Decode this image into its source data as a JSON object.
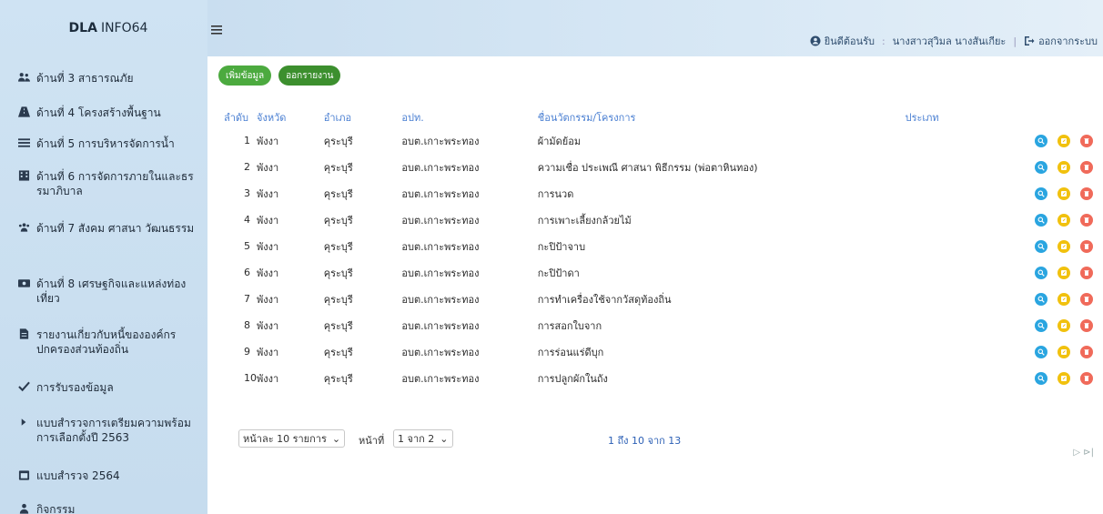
{
  "app": {
    "brand_bold": "DLA",
    "brand_light": "INFO64"
  },
  "sidebar": {
    "items": [
      {
        "icon": "users-icon",
        "label": "ด้านที่ 3 สาธารณภัย"
      },
      {
        "icon": "road-icon",
        "label": "ด้านที่ 4 โครงสร้างพื้นฐาน"
      },
      {
        "icon": "water-icon",
        "label": "ด้านที่ 5 การบริหารจัดการน้ำ"
      },
      {
        "icon": "building-icon",
        "label": "ด้านที่ 6 การจัดการภายในและธรรมาภิบาล"
      },
      {
        "icon": "group-icon",
        "label": "ด้านที่ 7 สังคม ศาสนา วัฒนธรรม"
      },
      {
        "icon": "ticket-icon",
        "label": "ด้านที่ 8 เศรษฐกิจและแหล่งท่องเที่ยว"
      },
      {
        "icon": "document-icon",
        "label": "รายงานเกี่ยวกับหนี้ขององค์กรปกครองส่วนท้องถิ่น"
      },
      {
        "icon": "check-icon",
        "label": "การรับรองข้อมูล"
      },
      {
        "icon": "chevron-right-icon",
        "label": "แบบสำรวจการเตรียมความพร้อมการเลือกตั้งปี 2563"
      },
      {
        "icon": "calendar-icon",
        "label": "แบบสำรวจ 2564"
      },
      {
        "icon": "user-icon",
        "label": "กิจกรรม"
      }
    ]
  },
  "topbar": {
    "welcome": "ยินดีต้อนรับ",
    "username": "นางสาวสุวิมล นางสันเกียะ",
    "logout": "ออกจากระบบ"
  },
  "toolbar": {
    "add_label": "เพิ่มข้อมูล",
    "report_label": "ออกรายงาน"
  },
  "table": {
    "headers": [
      "ลำดับ",
      "จังหวัด",
      "อำเภอ",
      "อปท.",
      "ชื่อนวัตกรรม/โครงการ",
      "ประเภท",
      ""
    ],
    "rows": [
      [
        "1",
        "พังงา",
        "คุระบุรี",
        "อบต.เกาะพระทอง",
        "ผ้ามัดย้อม"
      ],
      [
        "2",
        "พังงา",
        "คุระบุรี",
        "อบต.เกาะพระทอง",
        "ความเชื่อ ประเพณี ศาสนา พิธีกรรม (พ่อตาหินทอง)"
      ],
      [
        "3",
        "พังงา",
        "คุระบุรี",
        "อบต.เกาะพระทอง",
        "การนวด"
      ],
      [
        "4",
        "พังงา",
        "คุระบุรี",
        "อบต.เกาะพระทอง",
        "การเพาะเลี้ยงกล้วยไม้"
      ],
      [
        "5",
        "พังงา",
        "คุระบุรี",
        "อบต.เกาะพระทอง",
        "กะปิป้าจาบ"
      ],
      [
        "6",
        "พังงา",
        "คุระบุรี",
        "อบต.เกาะพระทอง",
        "กะปิป้าดา"
      ],
      [
        "7",
        "พังงา",
        "คุระบุรี",
        "อบต.เกาะพระทอง",
        "การทำเครื่องใช้จากวัสดุท้องถิ่น"
      ],
      [
        "8",
        "พังงา",
        "คุระบุรี",
        "อบต.เกาะพระทอง",
        "การสอกใบจาก"
      ],
      [
        "9",
        "พังงา",
        "คุระบุรี",
        "อบต.เกาะพระทอง",
        "การร่อนแร่ดีบุก"
      ],
      [
        "10",
        "พังงา",
        "คุระบุรี",
        "อบต.เกาะพระทอง",
        "การปลูกผักในถัง"
      ]
    ]
  },
  "footer": {
    "per_page": "หน้าละ 10 รายการ",
    "page_label": "หน้าที่",
    "page_value": "1 จาก 2",
    "range": "1 ถึง 10 จาก 13",
    "nav": "▷ ⊳|"
  },
  "colors": {
    "sidebar_bg": "#cfe3f3",
    "header_text": "#4a7fd2",
    "add_button": "#4caa3f",
    "report_button": "#3c8f2e",
    "view_button": "#2aa5e0",
    "edit_button": "#f1c10e",
    "delete_button": "#f06a5a"
  }
}
